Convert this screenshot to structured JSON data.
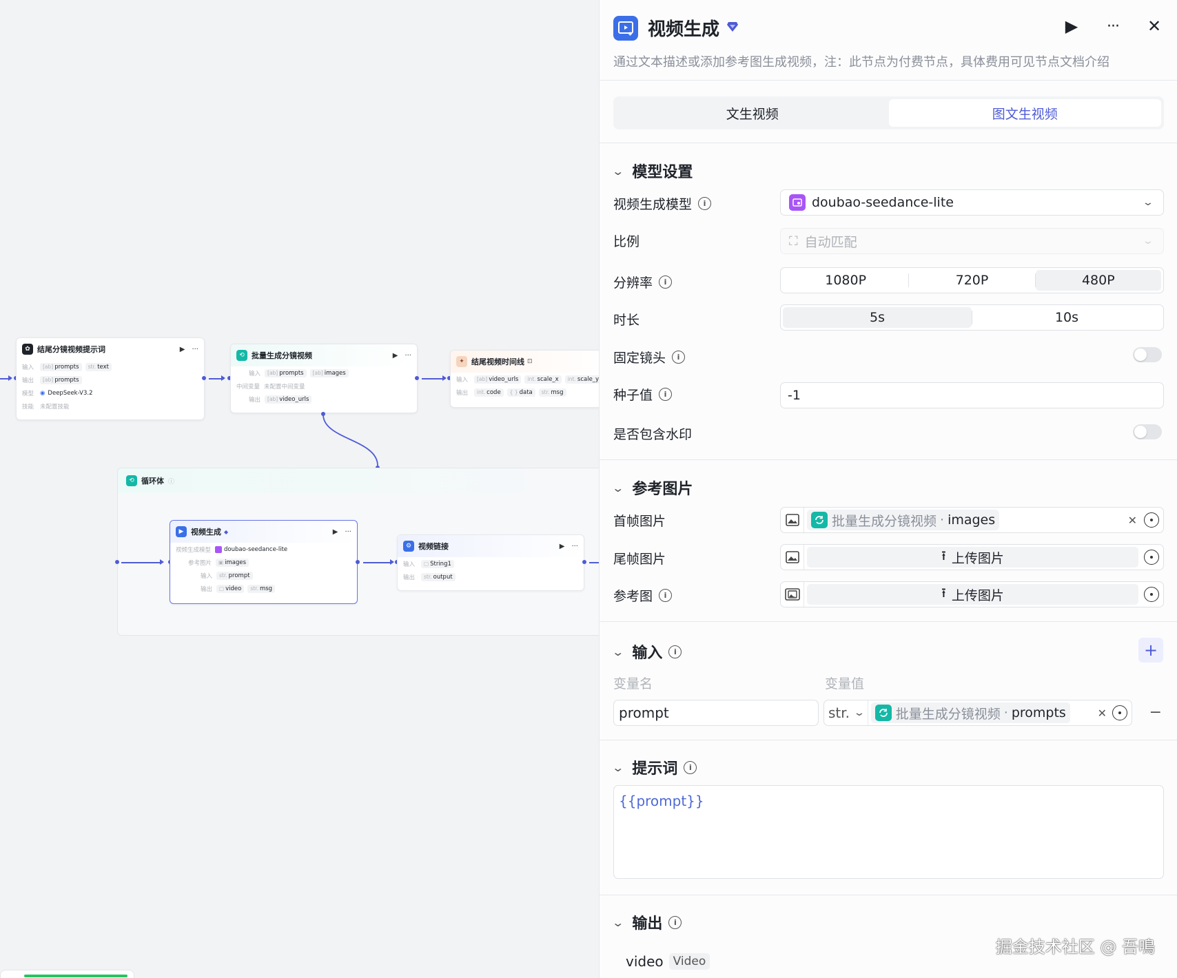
{
  "canvas": {
    "node1": {
      "title": "结尾分镜视频提示词",
      "in_label": "输入",
      "in_tags": [
        {
          "t": "[ab]",
          "v": "prompts"
        },
        {
          "t": "str.",
          "v": "text"
        }
      ],
      "out_label": "输出",
      "out_tags": [
        {
          "t": "[ab]",
          "v": "prompts"
        }
      ],
      "model_label": "模型",
      "model_value": "DeepSeek-V3.2",
      "skill_label": "技能",
      "skill_value": "未配置技能"
    },
    "node2": {
      "title": "批量生成分镜视频",
      "in_label": "输入",
      "in_tags": [
        {
          "t": "[ab]",
          "v": "prompts"
        },
        {
          "t": "[ab]",
          "v": "images"
        }
      ],
      "mid_label": "中间变量",
      "mid_value": "未配置中间变量",
      "out_label": "输出",
      "out_tags": [
        {
          "t": "[ab]",
          "v": "video_urls"
        }
      ]
    },
    "node3": {
      "title": "结尾视频时间线",
      "in_label": "输入",
      "in_tags": [
        {
          "t": "[ab]",
          "v": "video_urls"
        },
        {
          "t": "int.",
          "v": "scale_x"
        },
        {
          "t": "int.",
          "v": "scale_y"
        }
      ],
      "out_label": "输出",
      "out_tags": [
        {
          "t": "int.",
          "v": "code"
        },
        {
          "t": "{ }",
          "v": "data"
        },
        {
          "t": "str.",
          "v": "msg"
        }
      ]
    },
    "loop": {
      "title": "循环体"
    },
    "node4": {
      "title": "视频生成",
      "model_label": "视频生成模型",
      "model_value": "doubao-seedance-lite",
      "ref_label": "参考图片",
      "ref_value": "images",
      "in_label": "输入",
      "in_tags": [
        {
          "t": "str.",
          "v": "prompt"
        }
      ],
      "out_label": "输出",
      "out_tags": [
        {
          "t": "▢",
          "v": "video"
        },
        {
          "t": "str.",
          "v": "msg"
        }
      ]
    },
    "node5": {
      "title": "视频链接",
      "in_label": "输入",
      "in_tags": [
        {
          "t": "▢",
          "v": "String1"
        }
      ],
      "out_label": "输出",
      "out_tags": [
        {
          "t": "str.",
          "v": "output"
        }
      ]
    }
  },
  "panel": {
    "title": "视频生成",
    "description": "通过文本描述或添加参考图生成视频，注：此节点为付费节点，具体费用可见节点文档介绍",
    "tabs": [
      "文生视频",
      "图文生视频"
    ],
    "active_tab": "图文生视频",
    "model_section": {
      "title": "模型设置",
      "model_label": "视频生成模型",
      "model_value": "doubao-seedance-lite",
      "ratio_label": "比例",
      "ratio_value": "自动匹配",
      "resolution_label": "分辨率",
      "resolution_options": [
        "1080P",
        "720P",
        "480P"
      ],
      "resolution_selected": "480P",
      "duration_label": "时长",
      "duration_options": [
        "5s",
        "10s"
      ],
      "duration_selected": "5s",
      "fixed_camera_label": "固定镜头",
      "seed_label": "种子值",
      "seed_value": "-1",
      "watermark_label": "是否包含水印"
    },
    "ref_section": {
      "title": "参考图片",
      "first_frame_label": "首帧图片",
      "first_frame_ref_node": "批量生成分镜视频",
      "first_frame_ref_field": "images",
      "last_frame_label": "尾帧图片",
      "upload_label": "上传图片",
      "ref_image_label": "参考图"
    },
    "input_section": {
      "title": "输入",
      "col_name": "变量名",
      "col_value": "变量值",
      "var_name": "prompt",
      "var_type": "str.",
      "ref_node": "批量生成分镜视频",
      "ref_field": "prompts"
    },
    "prompt_section": {
      "title": "提示词",
      "value": "{{prompt}}"
    },
    "output_section": {
      "title": "输出",
      "var_name": "video",
      "var_type": "Video"
    },
    "dot_separator": "·"
  },
  "watermark": "掘金技术社区 @ 吾鳴",
  "colors": {
    "accent": "#4e5bd6",
    "teal": "#14b8a6",
    "model_purple": "#a855f7",
    "blue_icon": "#3b6fe8"
  }
}
